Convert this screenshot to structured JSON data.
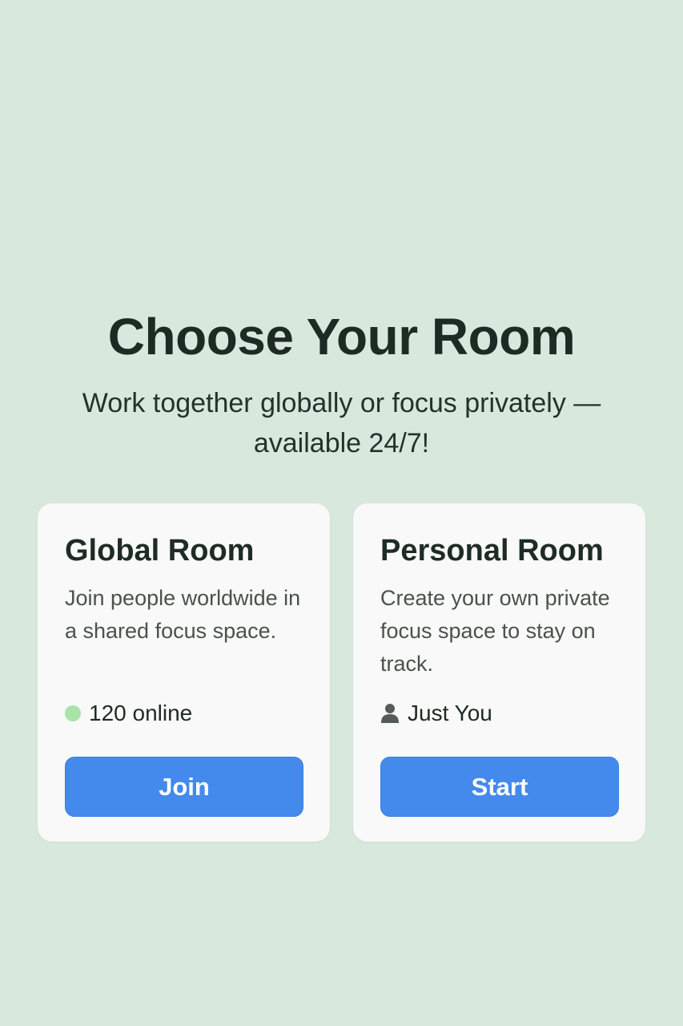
{
  "hero": {
    "title": "Choose Your Room",
    "subtitle": "Work together globally or focus privately — available 24/7!"
  },
  "cards": [
    {
      "title": "Global Room",
      "description": "Join people worldwide in a shared focus space.",
      "status_icon": "online-dot-icon",
      "status_text": "120 online",
      "button_label": "Join"
    },
    {
      "title": "Personal Room",
      "description": "Create your own private focus space to stay on track.",
      "status_icon": "user-icon",
      "status_text": "Just You",
      "button_label": "Start"
    }
  ],
  "colors": {
    "background": "#d9e8dc",
    "card": "#f8f9f8",
    "button": "#4489ec",
    "online_dot": "#a8e3a7",
    "heading": "#1e2b24"
  }
}
